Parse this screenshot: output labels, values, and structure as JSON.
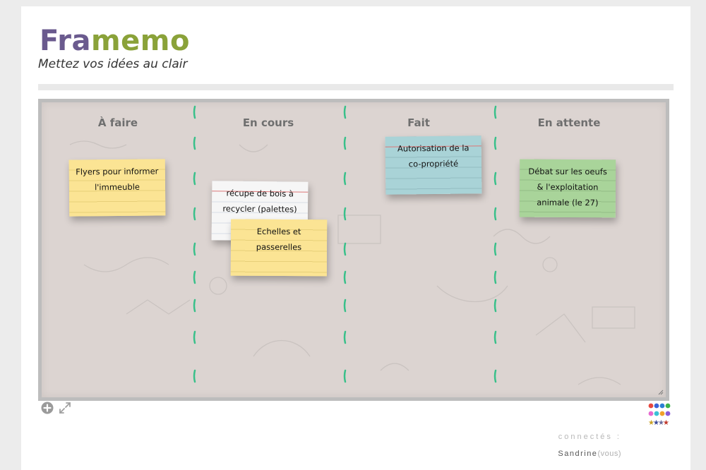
{
  "header": {
    "logo_part1": "Fra",
    "logo_part2": "memo",
    "tagline": "Mettez vos idées au clair"
  },
  "colors": {
    "logo_purple": "#6a5a8e",
    "logo_green": "#8aa239",
    "board_bg": "#dcd4d1",
    "separator": "#39c08a",
    "note_yellow": "#fbe494",
    "note_white": "#f6f6f6",
    "note_blue": "#a9d3d7",
    "note_green": "#a9d49a"
  },
  "board": {
    "columns": [
      "À faire",
      "En cours",
      "Fait",
      "En attente"
    ],
    "notes": [
      {
        "text": "Flyers pour informer l'immeuble",
        "color": "yellow",
        "column": "À faire"
      },
      {
        "text": "récupe de bois à recycler (palettes)",
        "color": "white",
        "column": "En cours"
      },
      {
        "text": "Echelles et passerelles",
        "color": "yellow",
        "column": "En cours"
      },
      {
        "text": "Autorisation de la co-propriété",
        "color": "blue",
        "column": "Fait"
      },
      {
        "text": "Débat sur les oeufs & l'exploitation animale (le 27)",
        "color": "green",
        "column": "En attente"
      }
    ]
  },
  "toolbar": {
    "add_icon": "plus-circle-icon",
    "fullscreen_icon": "expand-arrows-icon",
    "palette_icon": "color-palette-icon"
  },
  "presence": {
    "label": "connectés :",
    "user_name": "Sandrine",
    "you_suffix": "(vous)"
  }
}
